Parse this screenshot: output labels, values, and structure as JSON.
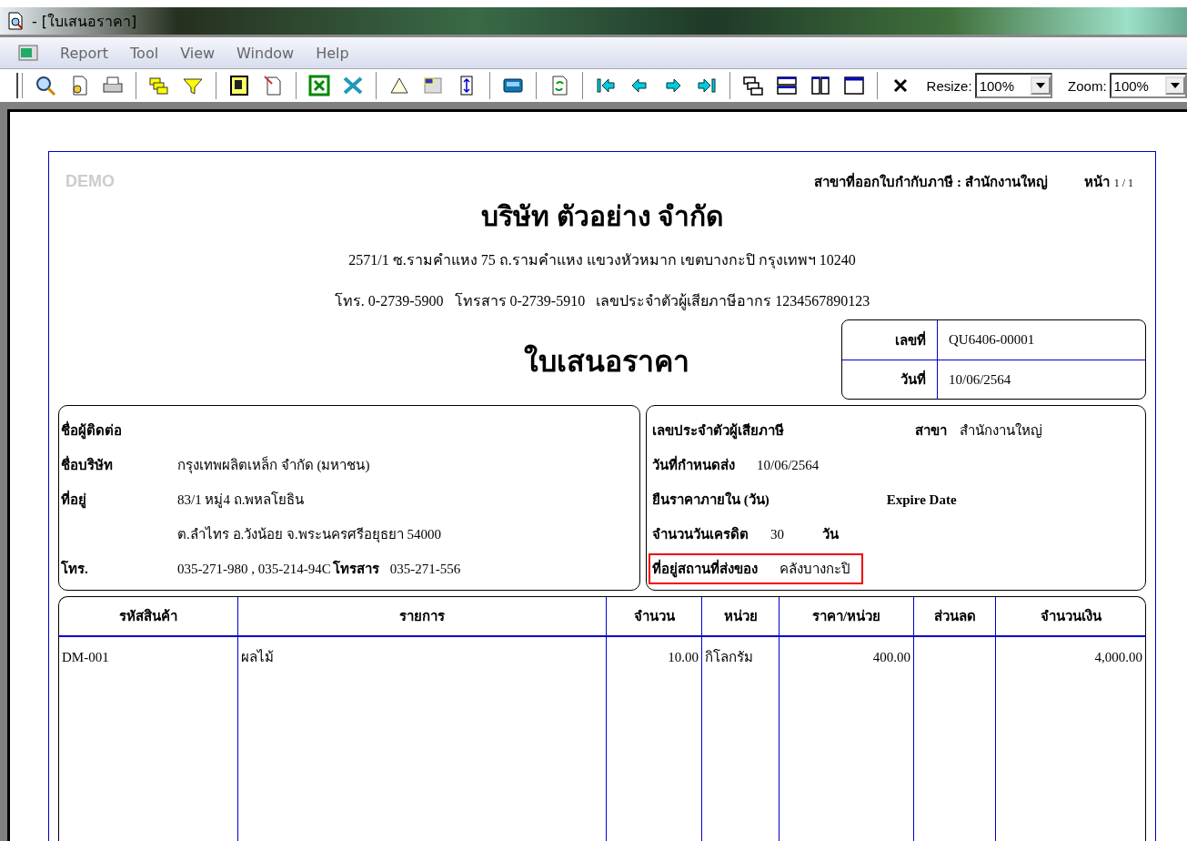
{
  "window": {
    "title": "- [ใบเสนอราคา]"
  },
  "menu": [
    "Report",
    "Tool",
    "View",
    "Window",
    "Help"
  ],
  "toolbar": {
    "resize": {
      "label": "Resize:",
      "value": "100%"
    },
    "zoom": {
      "label": "Zoom:",
      "value": "100%"
    }
  },
  "report": {
    "watermark": "DEMO",
    "branch_line": "สาขาที่ออกใบกำกับภาษี : สำนักงานใหญ่",
    "page_label": "หน้า",
    "page_value": "1 / 1",
    "company": "บริษัท ตัวอย่าง จำกัด",
    "address": "2571/1 ซ.รามคำแหง 75 ถ.รามคำแหง แขวงหัวหมาก เขตบางกะปิ กรุงเทพฯ 10240",
    "contact": "โทร. 0-2739-5900   โทรสาร 0-2739-5910   เลขประจำตัวผู้เสียภาษีอากร 1234567890123",
    "doc_title": "ใบเสนอราคา",
    "doc_info": [
      {
        "label": "เลขที่",
        "value": "QU6406-00001"
      },
      {
        "label": "วันที่",
        "value": "10/06/2564"
      }
    ],
    "customer": [
      {
        "label": "ชื่อผู้ติดต่อ"
      },
      {
        "label": "ชื่อบริษัท",
        "value": "กรุงเทพผลิตเหล็ก จำกัด (มหาชน)"
      },
      {
        "label": "ที่อยู่",
        "value": "83/1 หมู่4 ถ.พหลโยธิน"
      },
      {
        "value": "ต.ลำไทร อ.วังน้อย จ.พระนครศรีอยุธยา 54000"
      },
      {
        "label": "โทร.",
        "value": "035-271-980 , 035-214-94C",
        "extra_label": "โทรสาร",
        "extra_value": "035-271-556"
      }
    ],
    "terms": [
      {
        "label": "เลขประจำตัวผู้เสียภาษี",
        "extra_label": "สาขา",
        "extra_value": "สำนักงานใหญ่",
        "highlighted": false
      },
      {
        "label": "วันที่กำหนดส่ง",
        "value": "10/06/2564",
        "highlighted": false
      },
      {
        "label": "ยืนราคาภายใน (วัน)",
        "extra_label": "Expire Date",
        "highlighted": false
      },
      {
        "label": "จำนวนวันเครดิต",
        "value": "30",
        "extra_label": "วัน",
        "highlighted": false
      },
      {
        "label": "ที่อยู่สถานที่ส่งของ",
        "value": "คลังบางกะปิ",
        "highlighted": true
      }
    ],
    "table": {
      "columns": [
        "รหัสสินค้า",
        "รายการ",
        "จำนวน",
        "หน่วย",
        "ราคา/หน่วย",
        "ส่วนลด",
        "จำนวนเงิน"
      ],
      "rows": [
        [
          "DM-001",
          "ผลไม้",
          "10.00",
          "กิโลกรัม",
          "400.00",
          "",
          "4,000.00"
        ]
      ]
    }
  }
}
